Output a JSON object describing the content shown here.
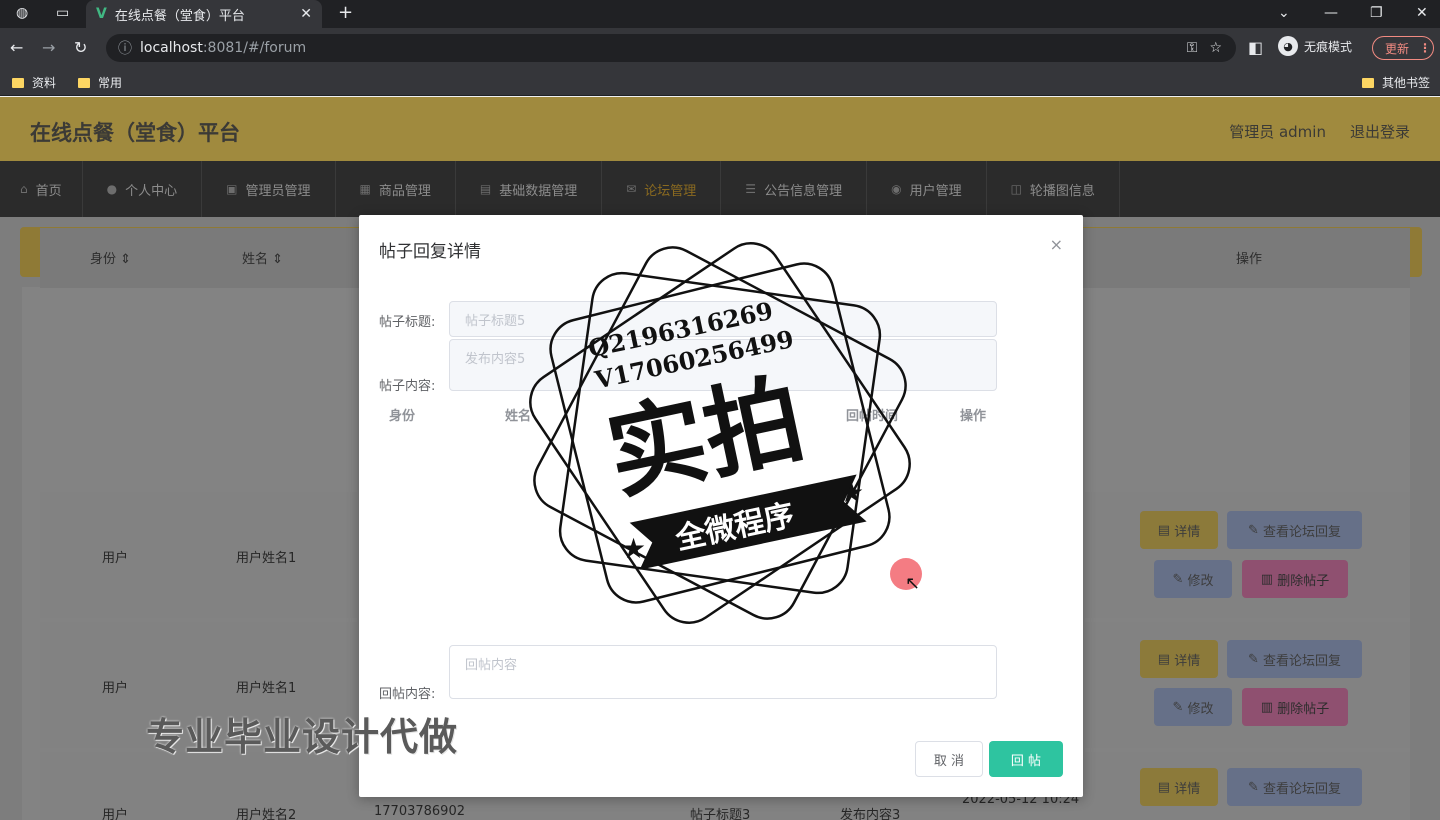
{
  "browser": {
    "tab_title": "在线点餐（堂食）平台",
    "url_scheme": "localhost",
    "url_rest": ":8081/#/forum",
    "incognito_label": "无痕模式",
    "update_label": "更新",
    "bookmarks": [
      "资料",
      "常用"
    ],
    "other_bookmarks": "其他书签"
  },
  "app": {
    "title": "在线点餐（堂食）平台",
    "user_label": "管理员 admin",
    "logout_label": "退出登录"
  },
  "menu": [
    {
      "label": "首页",
      "icon": "home-icon"
    },
    {
      "label": "个人中心",
      "icon": "user-icon"
    },
    {
      "label": "管理员管理",
      "icon": "admin-icon"
    },
    {
      "label": "商品管理",
      "icon": "goods-icon"
    },
    {
      "label": "基础数据管理",
      "icon": "data-icon"
    },
    {
      "label": "论坛管理",
      "icon": "forum-icon"
    },
    {
      "label": "公告信息管理",
      "icon": "notice-icon"
    },
    {
      "label": "用户管理",
      "icon": "users-icon"
    },
    {
      "label": "轮播图信息",
      "icon": "carousel-icon"
    }
  ],
  "table": {
    "headers": {
      "identity": "身份",
      "name": "姓名",
      "actions": "操作"
    },
    "rows": [
      {
        "identity": "用户",
        "name": "用户姓名1"
      },
      {
        "identity": "用户",
        "name": "用户姓名1"
      },
      {
        "identity": "用户",
        "name": "用户姓名2",
        "phone": "17703786902",
        "title": "帖子标题3",
        "content": "发布内容3",
        "time": "2022-05-12 10:24"
      }
    ],
    "btn_detail": "详情",
    "btn_view_replies": "查看论坛回复",
    "btn_edit": "修改",
    "btn_delete": "删除帖子"
  },
  "dialog": {
    "title": "帖子回复详情",
    "close": "×",
    "label_title": "帖子标题:",
    "value_title": "帖子标题5",
    "label_content": "帖子内容:",
    "value_content": "发布内容5",
    "inner_headers": [
      "身份",
      "姓名",
      "回帖时间",
      "操作"
    ],
    "label_reply": "回帖内容:",
    "reply_placeholder": "回帖内容",
    "cancel_label": "取 消",
    "reply_label": "回 帖"
  },
  "watermark": {
    "qq": "Q2196316269",
    "vx": "V17060256499",
    "big": "实拍",
    "ribbon": "全微程序",
    "promo": "专业毕业设计代做"
  }
}
